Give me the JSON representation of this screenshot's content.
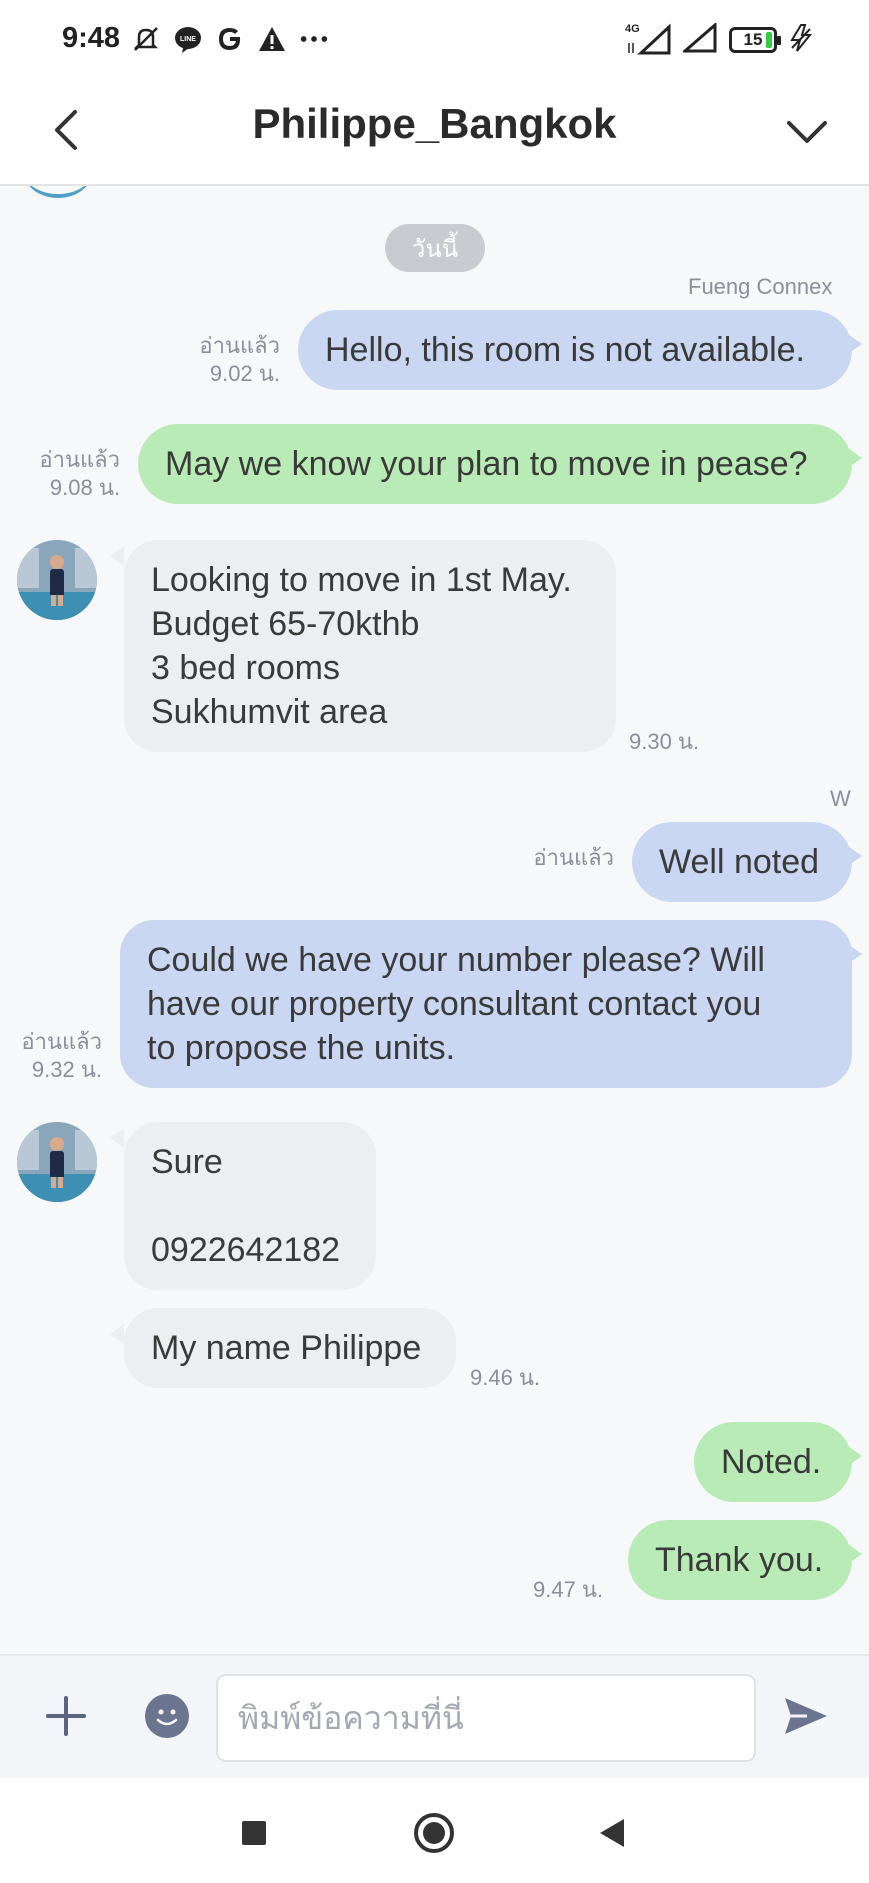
{
  "status_bar": {
    "time": "9:48",
    "left_icons": [
      "mute-icon",
      "line-icon",
      "google-icon",
      "warning-icon",
      "more-icon"
    ],
    "network_label": "4G",
    "battery": "15"
  },
  "header": {
    "title": "Philippe_Bangkok"
  },
  "chat": {
    "date_label": "วันนี้",
    "messages": [
      {
        "sender": "Fueng  Connex",
        "text": "Hello, this room is not available.",
        "read": "อ่านแล้ว",
        "time": "9.02 น."
      },
      {
        "text": "May we know your plan to move in pease?",
        "read": "อ่านแล้ว",
        "time": "9.08 น."
      },
      {
        "lines": [
          "Looking to move in 1st May.",
          "Budget 65-70kthb",
          "3 bed rooms",
          "Sukhumvit area"
        ],
        "time": "9.30 น."
      },
      {
        "sender": "W",
        "text": "Well noted",
        "read": "อ่านแล้ว"
      },
      {
        "lines": [
          "Could we have your number please? Will",
          "have our property consultant contact you",
          "to propose the units."
        ],
        "read": "อ่านแล้ว",
        "time": "9.32 น."
      },
      {
        "lines": [
          "Sure",
          "",
          "0922642182"
        ]
      },
      {
        "text": "My name Philippe",
        "time": "9.46 น."
      },
      {
        "text": "Noted."
      },
      {
        "text": "Thank you.",
        "time": "9.47 น."
      }
    ]
  },
  "input": {
    "placeholder": "พิมพ์ข้อความที่นี่"
  },
  "colors": {
    "blue_bubble": "#cad7f2",
    "green_bubble": "#b9ebb6",
    "gray_bubble": "#eceef1"
  }
}
